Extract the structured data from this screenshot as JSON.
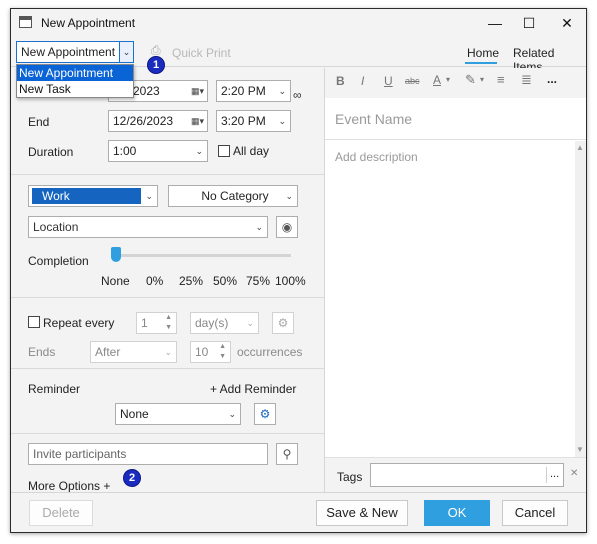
{
  "window": {
    "title": "New Appointment",
    "minimize": "—",
    "maximize": "☐",
    "close": "✕"
  },
  "toolbar": {
    "type_select": "New Appointment",
    "quick_print": "Quick Print",
    "tab_home": "Home",
    "tab_related": "Related Items"
  },
  "type_dropdown": {
    "options": [
      "New Appointment",
      "New Task"
    ]
  },
  "callouts": {
    "one": "1",
    "two": "2"
  },
  "schedule": {
    "start_date": "12/26/2023",
    "start_date_visible": "6/2023",
    "start_time": "2:20 PM",
    "end_label": "End",
    "end_date": "12/26/2023",
    "end_time": "3:20 PM",
    "duration_label": "Duration",
    "duration": "1:00",
    "all_day": "All day"
  },
  "category": {
    "status": "Work",
    "category": "No Category",
    "status_color": "#1565c0"
  },
  "location": {
    "placeholder": "Location"
  },
  "completion": {
    "label": "Completion",
    "ticks": [
      "None",
      "0%",
      "25%",
      "50%",
      "75%",
      "100%"
    ],
    "value": "None"
  },
  "recurrence": {
    "repeat_label": "Repeat every",
    "interval": "1",
    "unit": "day(s)",
    "ends_label": "Ends",
    "ends_mode": "After",
    "count": "10",
    "occurrences_label": "occurrences"
  },
  "reminder": {
    "label": "Reminder",
    "add": "+ Add Reminder",
    "value": "None"
  },
  "participants": {
    "placeholder": "Invite participants"
  },
  "more_options": "More Options +",
  "editor": {
    "bold": "B",
    "italic": "I",
    "underline": "U",
    "strike": "abc",
    "font_color": "A",
    "more": "...",
    "event_name_placeholder": "Event Name",
    "description_placeholder": "Add description"
  },
  "tags": {
    "label": "Tags",
    "more": "...",
    "clear": "✕"
  },
  "footer": {
    "delete": "Delete",
    "save_new": "Save & New",
    "ok": "OK",
    "cancel": "Cancel"
  },
  "colors": {
    "accent": "#2f9fe0",
    "selected": "#0a64d6",
    "callout": "#1a2cc0"
  }
}
